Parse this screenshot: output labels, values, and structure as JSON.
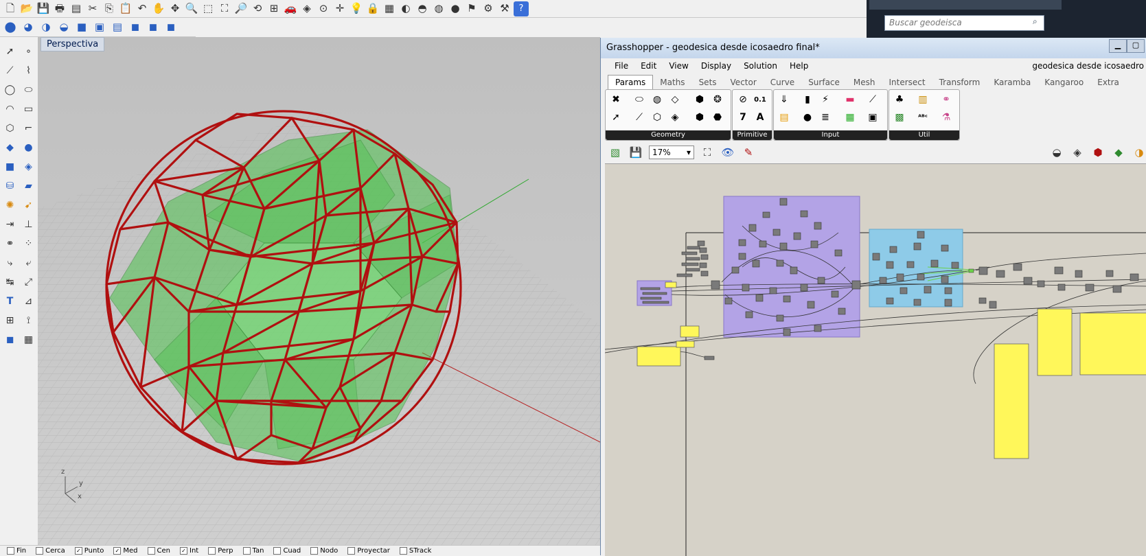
{
  "viewport": {
    "name": "Perspectiva",
    "axes": {
      "x": "x",
      "y": "y",
      "z": "z"
    }
  },
  "statusbar": {
    "snaps": [
      {
        "label": "Fin",
        "checked": false
      },
      {
        "label": "Cerca",
        "checked": false
      },
      {
        "label": "Punto",
        "checked": true
      },
      {
        "label": "Med",
        "checked": true
      },
      {
        "label": "Cen",
        "checked": false
      },
      {
        "label": "Int",
        "checked": true
      },
      {
        "label": "Perp",
        "checked": false
      },
      {
        "label": "Tan",
        "checked": false
      },
      {
        "label": "Cuad",
        "checked": false
      },
      {
        "label": "Nodo",
        "checked": false
      },
      {
        "label": "Proyectar",
        "checked": false
      },
      {
        "label": "STrack",
        "checked": false
      }
    ]
  },
  "search": {
    "placeholder": "Buscar geodeisca"
  },
  "gh": {
    "title": "Grasshopper - geodesica desde icosaedro final*",
    "doc_name": "geodesica desde icosaedro",
    "menu": [
      "File",
      "Edit",
      "View",
      "Display",
      "Solution",
      "Help"
    ],
    "tabs": [
      "Params",
      "Maths",
      "Sets",
      "Vector",
      "Curve",
      "Surface",
      "Mesh",
      "Intersect",
      "Transform",
      "Karamba",
      "Kangaroo",
      "Extra"
    ],
    "groups": [
      "Geometry",
      "Primitive",
      "Input",
      "Util"
    ],
    "zoom": "17%",
    "primitive_icons": [
      "0.1",
      "7",
      "A"
    ]
  },
  "colors": {
    "frame_red": "#b01010",
    "solid_green": "#4ec24e",
    "group_purple": "#b3a3e6",
    "group_blue": "#8ecbe8",
    "panel_yellow": "#fff75a",
    "canvas_bg": "#d6d2c8"
  }
}
